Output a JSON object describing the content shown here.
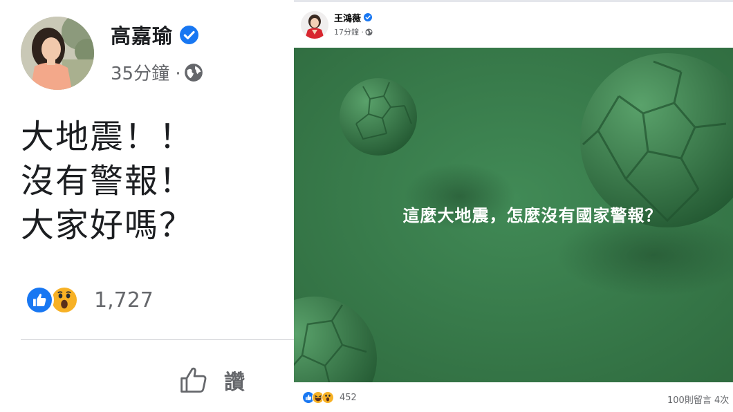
{
  "left_post": {
    "author": "高嘉瑜",
    "timestamp": "35分鐘 · ",
    "body_lines": [
      "大地震！！",
      "沒有警報！",
      "大家好嗎？"
    ],
    "reactions": [
      "like-icon",
      "wow-icon"
    ],
    "reaction_count": "1,727",
    "like_button_label": "讚",
    "colors": {
      "verified": "#1877f2",
      "like": "#1877f2",
      "wow": "#f7b125",
      "meta": "#65676b"
    }
  },
  "right_post": {
    "author": "王鴻薇",
    "timestamp": "17分鐘 · ",
    "image_headline": "這麼大地震，怎麼沒有國家警報？",
    "reactions": [
      "like-icon",
      "haha-icon",
      "wow-icon"
    ],
    "reaction_count": "452",
    "comments_shares": "100則留言 4次",
    "colors": {
      "image_background": "#3b7f4e",
      "headline_text": "#ffffff"
    }
  }
}
